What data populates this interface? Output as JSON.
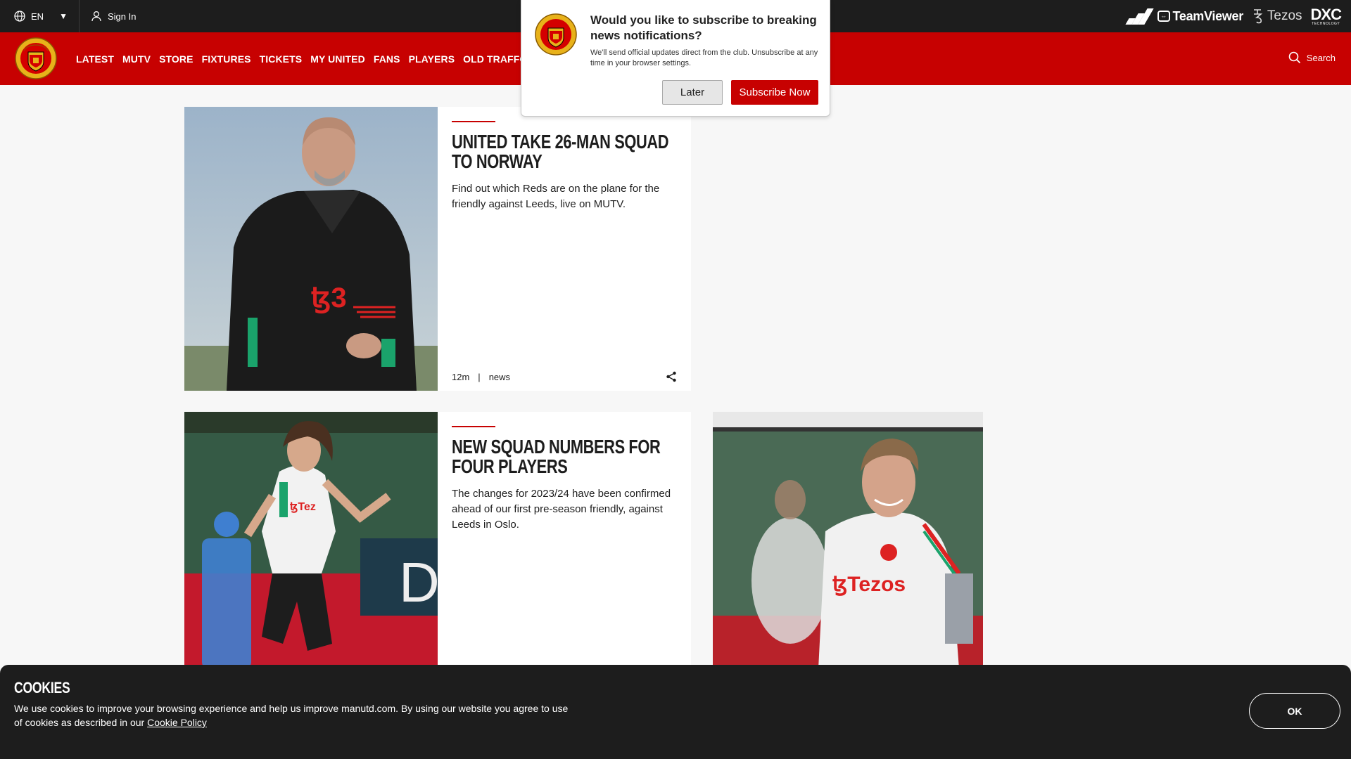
{
  "topbar": {
    "language": "EN",
    "signin_label": "Sign In",
    "sponsors": [
      "adidas",
      "TeamViewer",
      "Tezos",
      "DXC"
    ],
    "teamviewer_label": "TeamViewer",
    "tezos_label": "Tezos",
    "dxc_label": "DXC",
    "dxc_sub": "TECHNOLOGY"
  },
  "nav": {
    "items": [
      "LATEST",
      "MUTV",
      "STORE",
      "FIXTURES",
      "TICKETS",
      "MY UNITED",
      "FANS",
      "PLAYERS",
      "OLD TRAFFORD"
    ],
    "search_label": "Search"
  },
  "notification": {
    "title": "Would you like to subscribe to breaking news notifications?",
    "subtitle": "We'll send official updates direct from the club. Unsubscribe at any time in your browser settings.",
    "later_label": "Later",
    "subscribe_label": "Subscribe Now"
  },
  "articles": [
    {
      "title": "UNITED TAKE 26-MAN SQUAD TO NORWAY",
      "summary": "Find out which Reds are on the plane for the friendly against Leeds, live on MUTV.",
      "time": "12m",
      "separator": "|",
      "category": "news"
    },
    {
      "title": "NEW SQUAD NUMBERS FOR FOUR PLAYERS",
      "summary": "The changes for 2023/24 have been confirmed ahead of our first pre-season friendly, against Leeds in Oslo."
    }
  ],
  "cookies": {
    "title": "COOKIES",
    "text": "We use cookies to improve your browsing experience and help us improve manutd.com. By using our website you agree to use of cookies as described in our ",
    "link": "Cookie Policy",
    "ok_label": "OK"
  },
  "colors": {
    "brand_red": "#c70101",
    "dark": "#1d1d1d",
    "page_bg": "#f7f7f7"
  }
}
